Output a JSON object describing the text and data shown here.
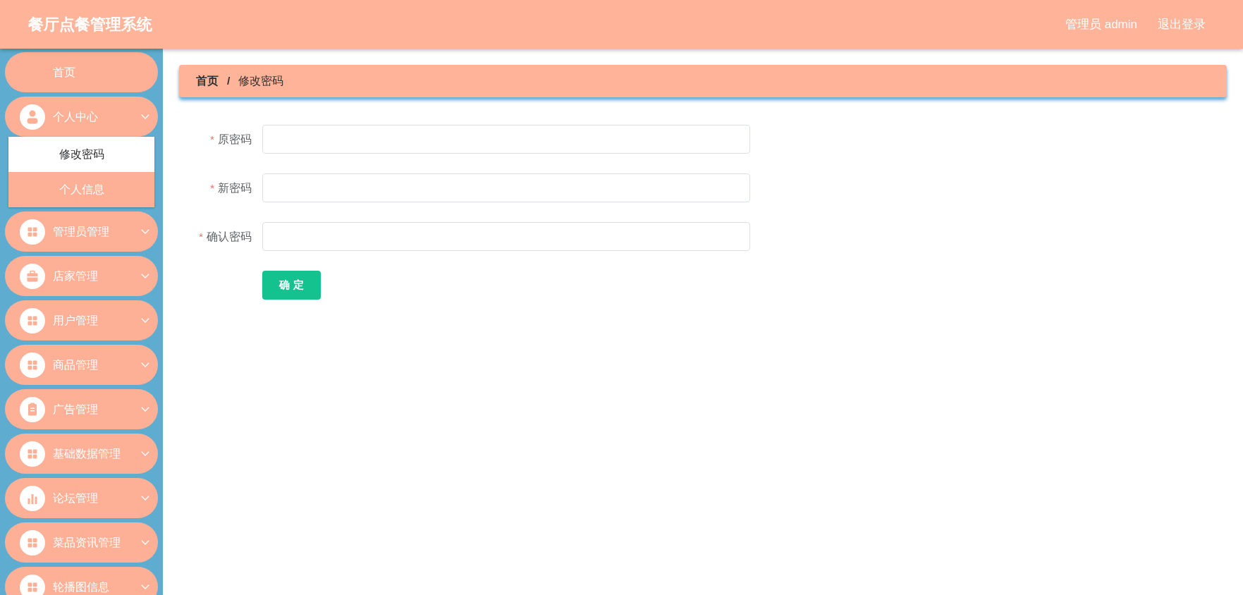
{
  "header": {
    "title": "餐厅点餐管理系统",
    "user": "管理员 admin",
    "logout": "退出登录"
  },
  "sidebar": {
    "items": [
      {
        "label": "首页",
        "kind": "link"
      },
      {
        "label": "个人中心",
        "kind": "submenu",
        "children": [
          {
            "label": "修改密码",
            "selected": true
          },
          {
            "label": "个人信息",
            "selected": false
          }
        ]
      },
      {
        "label": "管理员管理",
        "kind": "submenu"
      },
      {
        "label": "店家管理",
        "kind": "submenu"
      },
      {
        "label": "用户管理",
        "kind": "submenu"
      },
      {
        "label": "商品管理",
        "kind": "submenu"
      },
      {
        "label": "广告管理",
        "kind": "submenu"
      },
      {
        "label": "基础数据管理",
        "kind": "submenu"
      },
      {
        "label": "论坛管理",
        "kind": "submenu"
      },
      {
        "label": "菜品资讯管理",
        "kind": "submenu"
      },
      {
        "label": "轮播图信息",
        "kind": "submenu"
      }
    ]
  },
  "breadcrumb": {
    "separator": "/",
    "items": [
      {
        "label": "首页",
        "current": false
      },
      {
        "label": "修改密码",
        "current": true
      }
    ]
  },
  "form": {
    "required_mark": "*",
    "fields": [
      {
        "label": "原密码",
        "required": true
      },
      {
        "label": "新密码",
        "required": true
      },
      {
        "label": "确认密码",
        "required": true
      }
    ],
    "submit": "确 定"
  }
}
